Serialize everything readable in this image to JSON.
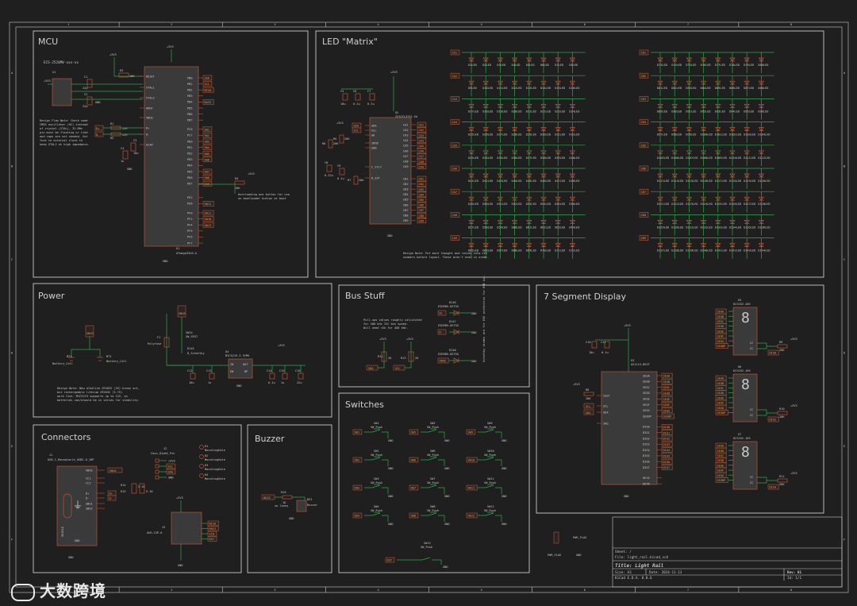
{
  "frame": {
    "top_ticks": [
      "1",
      "2",
      "3",
      "4",
      "5",
      "6",
      "7",
      "8"
    ],
    "side_ticks": [
      "A",
      "B",
      "C",
      "D",
      "E",
      "F"
    ]
  },
  "sections": {
    "mcu": "MCU",
    "led": "LED \"Matrix\"",
    "power": "Power",
    "bus": "Bus Stuff",
    "seg": "7 Segment Display",
    "switches": "Switches",
    "connectors": "Connectors",
    "buzzer": "Buzzer"
  },
  "mcu": {
    "crystal": "ECS-2520MV-xxx-xx",
    "x_ref": "X1",
    "u_ref": "U1",
    "u_value": "ATmega32U4-A",
    "rails": [
      "+3V3",
      "+3V3",
      "+3V3"
    ],
    "gnd": "GND",
    "caps": [
      {
        "ref": "C1",
        "val": "22p"
      },
      {
        "ref": "C2",
        "val": "22p"
      },
      {
        "ref": "C3",
        "val": "10u"
      },
      {
        "ref": "C4",
        "val": "1u"
      }
    ],
    "resistors": [
      {
        "ref": "R1",
        "val": "22R"
      },
      {
        "ref": "R2",
        "val": "22R"
      },
      {
        "ref": "R3",
        "val": "10K"
      },
      {
        "ref": "R4",
        "val": "10K"
      }
    ],
    "left_pins": [
      "RESET",
      "XTAL1",
      "XTAL2",
      "AREF",
      "VBUS",
      "D+",
      "D-",
      "UCAP"
    ],
    "right_pins": [
      "PB0",
      "PB1",
      "PB2",
      "PB3",
      "PB4",
      "PB5",
      "PB6",
      "PB7",
      "PC6",
      "PC7",
      "PD0",
      "PD1",
      "PD2",
      "PD3",
      "PD4",
      "PD5",
      "PD6",
      "PD7",
      "PE2",
      "PE6",
      "PF0",
      "PF1",
      "PF4",
      "PF5",
      "PF6",
      "PF7"
    ],
    "net_labels": [
      "SDA",
      "SCL",
      "MISO",
      "BUZZ",
      "SW1",
      "SW2",
      "SW3",
      "SW4",
      "SW5",
      "SW6",
      "SW7",
      "SW8",
      "SW9",
      "SW10",
      "SW11",
      "SW12",
      "SW13",
      "D+",
      "D-"
    ],
    "note1": "Design Flaw Note: Check some CMOS oscillator (HC) instead of crystal (XTAL), 32-MHz pin must be floating or tied and caps are not needed. Set fuse to external clock to keep XTAL2 at high impedance.",
    "note2": "Overloading one button for use as bootloader button at boot"
  },
  "led": {
    "driver_ref": "U2",
    "driver_value": "IS31FL3731-SA",
    "rail": "+3V3",
    "caps": [
      {
        "ref": "C5",
        "val": "10u"
      },
      {
        "ref": "C6",
        "val": "0.1u"
      },
      {
        "ref": "C7",
        "val": "0.1u"
      },
      {
        "ref": "C8",
        "val": "0.22u"
      },
      {
        "ref": "C9",
        "val": "0.1u"
      }
    ],
    "resistors": [
      {
        "ref": "R5",
        "val": "20K"
      },
      {
        "ref": "R6",
        "val": "20K"
      },
      {
        "ref": "R7",
        "val": "20K"
      }
    ],
    "left_pins": [
      "SDA",
      "SCL",
      "AD",
      "INTB",
      "SDB",
      "C_FILT",
      "R_EXT"
    ],
    "right_top": [
      "CA1",
      "CA2",
      "CA3",
      "CA4",
      "CA5",
      "CA6",
      "CA7",
      "CA8",
      "CA9"
    ],
    "right_bot": [
      "CB1",
      "CB2",
      "CB3",
      "CB4",
      "CB5",
      "CB6",
      "CB7",
      "CB8",
      "CB9"
    ],
    "ca_labels": [
      "CA1",
      "CA2",
      "CA3",
      "CA4",
      "CA5",
      "CA6",
      "CA7",
      "CA8",
      "CA9"
    ],
    "cb_labels": [
      "CB1",
      "CB2",
      "CB3",
      "CB4",
      "CB5",
      "CB6",
      "CB7",
      "CB8",
      "CB9"
    ],
    "led_value": "LED",
    "note": "Design Note: Put more thought and review into LED numbers before layout. These aren't even in order."
  },
  "power": {
    "rails": [
      "VBUS",
      "VBUS",
      "+3V3"
    ],
    "bt1": "BT1",
    "bt1_val": "Battery_Cell",
    "bt2": "BT2",
    "bt2_val": "Battery_Cell",
    "f1": "F1",
    "f1_val": "Polyfuse",
    "sw": "SW14",
    "sw_val": "SW_SPST",
    "d": "D145",
    "d_val": "D_Schottky",
    "u": "U4",
    "u_val": "MIC5219-3.3YM5",
    "u_pins": [
      "IN",
      "EN",
      "OUT",
      "BP",
      "GND"
    ],
    "caps": [
      {
        "ref": "C12",
        "val": "10u"
      },
      {
        "ref": "C13",
        "val": "1u"
      },
      {
        "ref": "C14",
        "val": "0.1u"
      },
      {
        "ref": "C15",
        "val": "1u"
      },
      {
        "ref": "C16",
        "val": "22u"
      }
    ],
    "note": "Design Note: New alkaline CR2032 (3V) brown out, but rechargeable lithium CR2032 (3.7V) work fine. MIC5219 supports up to 12V, so batteries can/should be in series for stability."
  },
  "bus": {
    "note": "Pull-ups values roughly calculated for 400 kHz I2C bus speed. Will need <5k for 400 kHz.",
    "schottky_note": "Schottky diodes are for ESD protection for USB bus.",
    "diodes": [
      {
        "ref": "D146",
        "val": "ESD9B5.0ST5G"
      },
      {
        "ref": "D147",
        "val": "ESD9B5.0ST5G"
      },
      {
        "ref": "D148",
        "val": "ESD9B5.0ST5G"
      }
    ],
    "res": [
      {
        "ref": "R11",
        "val": "2K"
      },
      {
        "ref": "R13",
        "val": "2K"
      }
    ],
    "labels": [
      "SDA",
      "SCL",
      "D+",
      "D-",
      "VBUS"
    ],
    "rail": "+3V3"
  },
  "seg": {
    "u_ref": "U3",
    "u_val": "AS1115-BSST",
    "rail": "+3V3",
    "caps": [
      {
        "ref": "C10",
        "val": "10u"
      },
      {
        "ref": "C11",
        "val": "0.1u"
      }
    ],
    "r8": "R8",
    "r8_val": "20K",
    "left_pins": [
      "ISET",
      "SCL",
      "SDA",
      "IRQ"
    ],
    "right_pins": [
      "SEGA",
      "SEGB",
      "SEGC",
      "SEGD",
      "SEGE",
      "SEGF",
      "SEGG",
      "SEGDP",
      "DIG0",
      "DIG1",
      "DIG2",
      "DIG3",
      "DIG4",
      "DIG5",
      "DIG6",
      "DIG7",
      "KEYA",
      "KEYB"
    ],
    "displays": [
      {
        "ref": "U5",
        "val": "KCSC02-105"
      },
      {
        "ref": "U6",
        "val": "KCSC02-105"
      },
      {
        "ref": "U7",
        "val": "KCSC02-105"
      }
    ],
    "disp_res": [
      {
        "ref": "R9",
        "val": "20K"
      },
      {
        "ref": "R10",
        "val": "20K"
      },
      {
        "ref": "R11",
        "val": "20K"
      }
    ],
    "seg_labels": [
      "SEGA",
      "SEGB",
      "SEGC",
      "SEGD",
      "SEGE",
      "SEGF",
      "SEGG",
      "SEGDP"
    ],
    "pins_right": [
      "CC",
      "CC"
    ]
  },
  "switches": {
    "value": "SW_Push",
    "refs": [
      "SW1",
      "SW2",
      "SW3",
      "SW4",
      "SW5",
      "SW6",
      "SW7",
      "SW8",
      "SW9",
      "SW10",
      "SW11",
      "SW12",
      "SW13"
    ],
    "labels": [
      "SW1",
      "SW2",
      "SW3",
      "SW4",
      "SW5",
      "SW6",
      "SW7",
      "SW8",
      "SW9",
      "SW10",
      "SW11",
      "SW12",
      "RST"
    ],
    "gnd": "GND"
  },
  "connectors": {
    "j1": "J1",
    "j1_val": "USB_C_Receptacle_USB2.0_16P",
    "j1_pins": [
      "VBUS",
      "CC1",
      "CC2",
      "D+",
      "D-",
      "SBU1",
      "SBU2",
      "SHIELD",
      "GND"
    ],
    "j2": "J2",
    "j2_val": "Conn_01x04_Pin",
    "j2_labels": [
      "+3V3",
      "SCL",
      "SDA",
      "GND"
    ],
    "j3": "J3",
    "j3_val": "AVR-ISP-6",
    "j3_labels": [
      "MISO",
      "MOSI",
      "SCK",
      "RST"
    ],
    "res": [
      {
        "ref": "R14",
        "val": "5.1K"
      },
      {
        "ref": "R15",
        "val": "5.1K"
      }
    ],
    "holes": [
      {
        "ref": "H1",
        "val": "MountingHole"
      },
      {
        "ref": "H2",
        "val": "MountingHole"
      },
      {
        "ref": "H3",
        "val": "MountingHole"
      },
      {
        "ref": "H4",
        "val": "MountingHole"
      }
    ],
    "rail": "+3V3"
  },
  "buzzer": {
    "label": "BUZZ",
    "r": "R16",
    "r_val": "1K",
    "note": "so loney",
    "bz": "BZ1",
    "bz_val": "Buzzer",
    "gnd": "GND"
  },
  "pwr_flags": [
    "PWR_FLAG",
    "PWR_FLAG"
  ],
  "title_block": {
    "sheet": "Sheet: /",
    "file": "File: light_rail.kicad_sch",
    "title": "Title: Light Rail",
    "size": "Size: A3",
    "date": "Date: 2024-11-13",
    "rev": "Rev: 01",
    "tool": "KiCad E.D.A. 8.0.6",
    "id": "Id: 1/1"
  },
  "watermark": "大数跨境"
}
